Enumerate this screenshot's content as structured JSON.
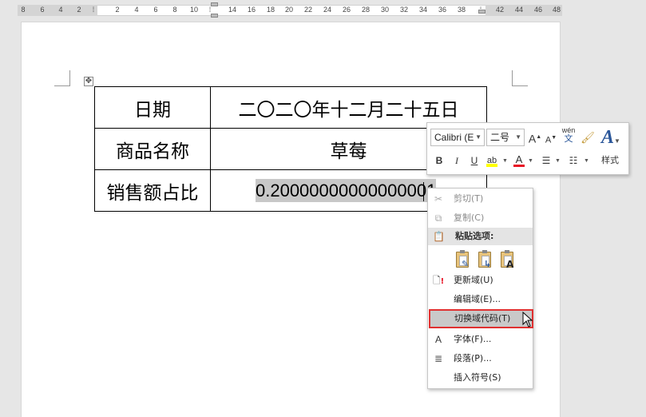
{
  "ruler": {
    "left_numbers": [
      "8",
      "6",
      "4",
      "2"
    ],
    "right_numbers": [
      "2",
      "4",
      "6",
      "8",
      "10",
      "14",
      "16",
      "18",
      "20",
      "22",
      "24",
      "26",
      "28",
      "30",
      "32",
      "34",
      "36",
      "38",
      "42",
      "44",
      "46",
      "48"
    ]
  },
  "table": {
    "rows": [
      {
        "label": "日期",
        "value": "二〇二〇年十二月二十五日"
      },
      {
        "label": "商品名称",
        "value": "草莓"
      },
      {
        "label": "销售额占比",
        "value": "0.20000000000000001"
      }
    ]
  },
  "mini_toolbar": {
    "font_name": "Calibri (E",
    "font_size": "二号",
    "grow_font": "A",
    "shrink_font": "A",
    "phonetic": "wén",
    "phonetic_char": "文",
    "bold": "B",
    "italic": "I",
    "underline": "U",
    "font_color": "A",
    "styles_glyph": "A",
    "styles_label": "样式"
  },
  "context_menu": {
    "items": [
      {
        "label": "剪切(T)",
        "enabled": false,
        "icon": "scissors-icon"
      },
      {
        "label": "复制(C)",
        "enabled": false,
        "icon": "copy-icon"
      },
      {
        "label": "粘贴选项:",
        "header": true,
        "icon": "paste-icon"
      },
      {
        "label": "更新域(U)",
        "enabled": true,
        "icon": "update-field-icon"
      },
      {
        "label": "编辑域(E)...",
        "enabled": true,
        "icon": ""
      },
      {
        "label": "切换域代码(T)",
        "enabled": true,
        "highlighted": true,
        "icon": ""
      },
      {
        "label": "字体(F)...",
        "enabled": true,
        "icon": "font-icon"
      },
      {
        "label": "段落(P)...",
        "enabled": true,
        "icon": "paragraph-icon"
      },
      {
        "label": "插入符号(S)",
        "enabled": true,
        "icon": ""
      }
    ],
    "paste_options": [
      "keep-source-format-icon",
      "merge-format-icon",
      "keep-text-only-icon"
    ],
    "paste_glyph_text": "A",
    "font_glyph": "A"
  },
  "colors": {
    "highlight_border": "#e03131",
    "selection": "#c8c8c8",
    "styles_accent": "#2b579a",
    "font_color_bar": "#e81123",
    "highlight_bar": "#ffff00"
  }
}
